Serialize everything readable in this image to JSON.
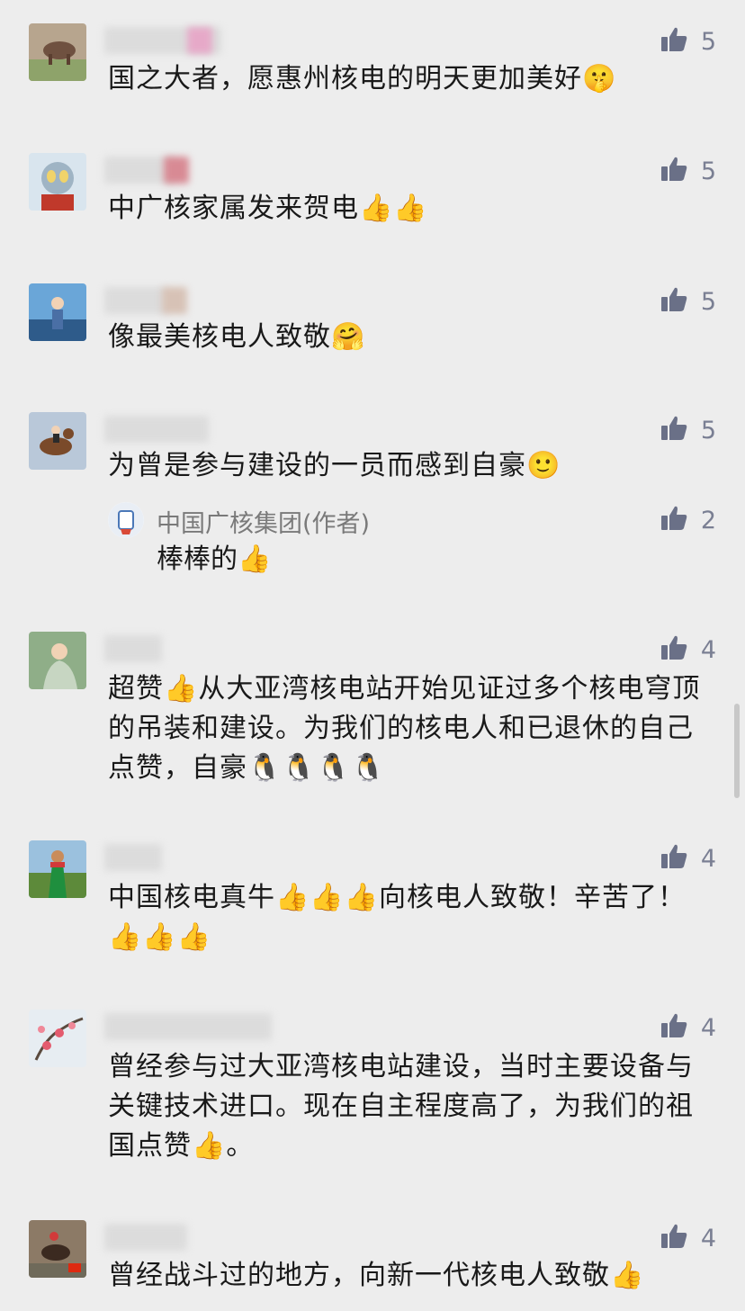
{
  "comments": [
    {
      "text": "国之大者，愿惠州核电的明天更加美好🤫",
      "likes": "5"
    },
    {
      "text": "中广核家属发来贺电👍👍",
      "likes": "5"
    },
    {
      "text": "像最美核电人致敬🤗",
      "likes": "5"
    },
    {
      "text": "为曾是参与建设的一员而感到自豪🙂",
      "likes": "5",
      "reply": {
        "author": "中国广核集团(作者)",
        "text": "棒棒的👍",
        "likes": "2"
      }
    },
    {
      "text": "超赞👍从大亚湾核电站开始见证过多个核电穹顶的吊装和建设。为我们的核电人和已退休的自己点赞，自豪🐧🐧🐧🐧",
      "likes": "4"
    },
    {
      "text": "中国核电真牛👍👍👍向核电人致敬！辛苦了！👍👍👍",
      "likes": "4"
    },
    {
      "text": "曾经参与过大亚湾核电站建设，当时主要设备与关键技术进口。现在自主程度高了，为我们的祖国点赞👍。",
      "likes": "4"
    },
    {
      "text": "曾经战斗过的地方，向新一代核电人致敬👍",
      "likes": "4"
    }
  ],
  "icons": {
    "like": "thumbs-up-icon",
    "avatar": "user-avatar"
  },
  "colors": {
    "background": "#ededed",
    "meta": "#7a7f93",
    "text": "#191919"
  }
}
